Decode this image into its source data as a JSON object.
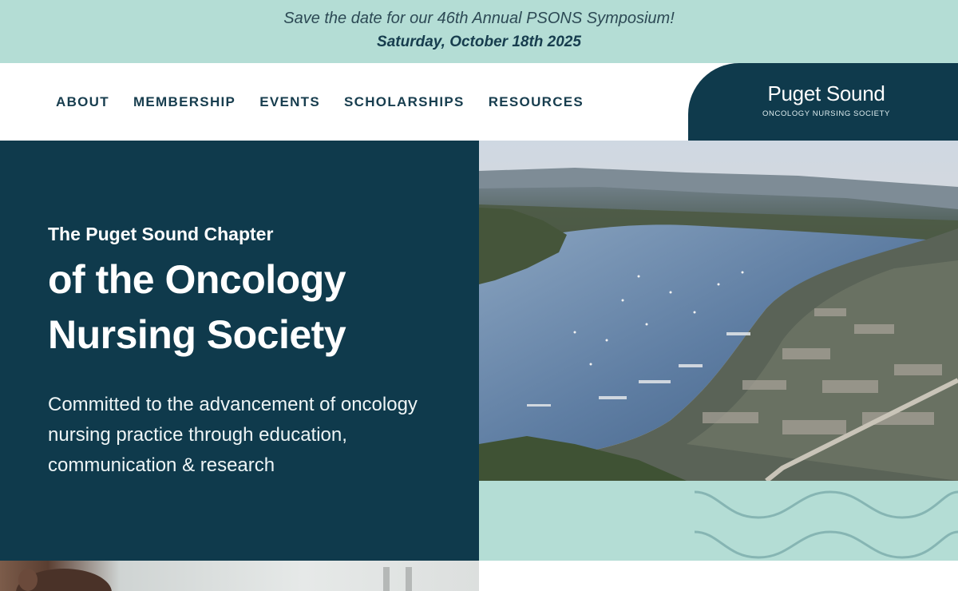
{
  "banner": {
    "line1": "Save the date for our 46th Annual PSONS Symposium!",
    "line2": "Saturday, October 18th 2025"
  },
  "nav": {
    "items": [
      {
        "label": "ABOUT"
      },
      {
        "label": "MEMBERSHIP"
      },
      {
        "label": "EVENTS"
      },
      {
        "label": "SCHOLARSHIPS"
      },
      {
        "label": "RESOURCES"
      }
    ]
  },
  "logo": {
    "title": "Puget Sound",
    "subtitle": "ONCOLOGY NURSING SOCIETY"
  },
  "hero": {
    "kicker": "The Puget Sound Chapter",
    "title_line1": "of the Oncology",
    "title_line2": "Nursing Society",
    "description": "Committed to the advancement of oncology nursing practice through education, communication & research"
  },
  "colors": {
    "brand_dark": "#0f3a4c",
    "brand_mint": "#b4ddd5",
    "wave_stroke": "#86b5b3"
  },
  "icons": {
    "decoration": "wave-lines-icon"
  }
}
